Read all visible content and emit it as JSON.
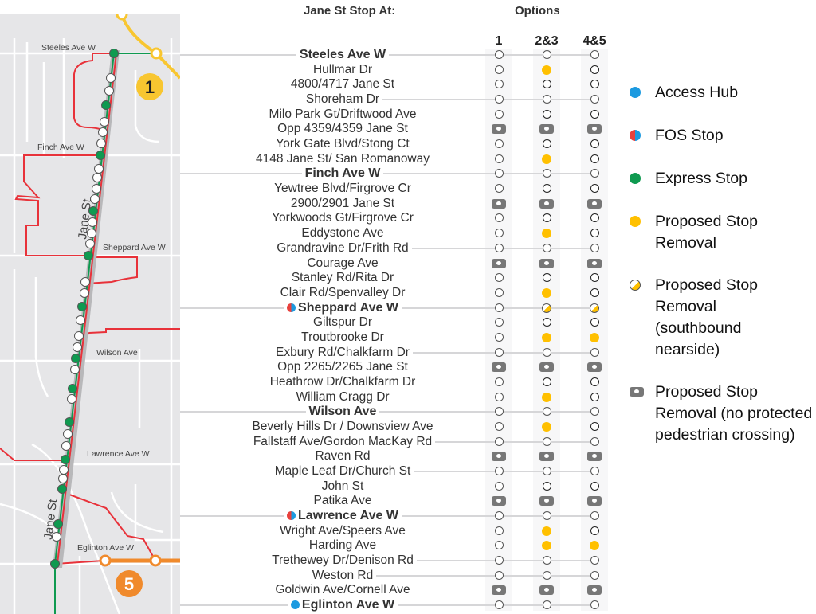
{
  "header": {
    "stop_col_title": "Jane St Stop At:",
    "options_title": "Options",
    "option_columns": [
      "1",
      "2&3",
      "4&5"
    ]
  },
  "map": {
    "street_labels": [
      "Steeles Ave W",
      "Finch Ave W",
      "Sheppard Ave W",
      "Wilson Ave",
      "Lawrence Ave W",
      "Eglinton Ave W",
      "Jane St",
      "Jane St"
    ],
    "line_badges": [
      {
        "label": "1",
        "color": "#f8c630"
      },
      {
        "label": "5",
        "color": "#f08a2c"
      }
    ],
    "colors": {
      "route_red": "#e8323a",
      "express_green": "#0f9a50",
      "line1_yellow": "#f8c630",
      "line5_orange": "#f08a2c",
      "land": "#e6e6e8",
      "roads": "#ffffff"
    }
  },
  "marker_types": {
    "open": "regular stop (retained)",
    "rem": "Proposed Stop Removal",
    "sb": "Proposed Stop Removal (southbound nearside)",
    "nopx": "Proposed Stop Removal (no protected pedestrian crossing)"
  },
  "stops": [
    {
      "name": "Steeles Ave W",
      "major": true,
      "badge": "",
      "options": [
        "open",
        "open",
        "open"
      ]
    },
    {
      "name": "Hullmar Dr",
      "major": false,
      "badge": "",
      "options": [
        "open",
        "rem",
        "open"
      ]
    },
    {
      "name": "4800/4717 Jane St",
      "major": false,
      "badge": "",
      "options": [
        "open",
        "open",
        "open"
      ]
    },
    {
      "name": "Shoreham Dr",
      "major": false,
      "badge": "",
      "connector": true,
      "options": [
        "open",
        "open",
        "open"
      ]
    },
    {
      "name": "Milo Park Gt/Driftwood Ave",
      "major": false,
      "badge": "",
      "options": [
        "open",
        "open",
        "open"
      ]
    },
    {
      "name": "Opp 4359/4359 Jane St",
      "major": false,
      "badge": "",
      "options": [
        "nopx",
        "nopx",
        "nopx"
      ]
    },
    {
      "name": "York Gate Blvd/Stong Ct",
      "major": false,
      "badge": "",
      "options": [
        "open",
        "open",
        "open"
      ]
    },
    {
      "name": "4148 Jane St/  San Romanoway",
      "major": false,
      "badge": "",
      "options": [
        "open",
        "rem",
        "open"
      ]
    },
    {
      "name": "Finch Ave W",
      "major": true,
      "badge": "",
      "options": [
        "open",
        "open",
        "open"
      ]
    },
    {
      "name": "Yewtree Blvd/Firgrove Cr",
      "major": false,
      "badge": "",
      "options": [
        "open",
        "open",
        "open"
      ]
    },
    {
      "name": "2900/2901 Jane St",
      "major": false,
      "badge": "",
      "options": [
        "nopx",
        "nopx",
        "nopx"
      ]
    },
    {
      "name": "Yorkwoods Gt/Firgrove Cr",
      "major": false,
      "badge": "",
      "options": [
        "open",
        "open",
        "open"
      ]
    },
    {
      "name": "Eddystone Ave",
      "major": false,
      "badge": "",
      "options": [
        "open",
        "rem",
        "open"
      ]
    },
    {
      "name": "Grandravine Dr/Frith Rd",
      "major": false,
      "badge": "",
      "connector": true,
      "options": [
        "open",
        "open",
        "open"
      ]
    },
    {
      "name": "Courage Ave",
      "major": false,
      "badge": "",
      "options": [
        "nopx",
        "nopx",
        "nopx"
      ]
    },
    {
      "name": "Stanley Rd/Rita Dr",
      "major": false,
      "badge": "",
      "options": [
        "open",
        "open",
        "open"
      ]
    },
    {
      "name": "Clair Rd/Spenvalley Dr",
      "major": false,
      "badge": "",
      "options": [
        "open",
        "rem",
        "open"
      ]
    },
    {
      "name": "Sheppard Ave W",
      "major": true,
      "badge": "fos",
      "options": [
        "open",
        "sb",
        "sb"
      ]
    },
    {
      "name": "Giltspur Dr",
      "major": false,
      "badge": "",
      "options": [
        "open",
        "open",
        "open"
      ]
    },
    {
      "name": "Troutbrooke Dr",
      "major": false,
      "badge": "",
      "options": [
        "open",
        "rem",
        "rem"
      ]
    },
    {
      "name": "Exbury Rd/Chalkfarm Dr",
      "major": false,
      "badge": "",
      "connector": true,
      "options": [
        "open",
        "open",
        "open"
      ]
    },
    {
      "name": "Opp 2265/2265 Jane St",
      "major": false,
      "badge": "",
      "options": [
        "nopx",
        "nopx",
        "nopx"
      ]
    },
    {
      "name": "Heathrow Dr/Chalkfarm Dr",
      "major": false,
      "badge": "",
      "options": [
        "open",
        "open",
        "open"
      ]
    },
    {
      "name": "William Cragg Dr",
      "major": false,
      "badge": "",
      "options": [
        "open",
        "rem",
        "open"
      ]
    },
    {
      "name": "Wilson Ave",
      "major": true,
      "badge": "",
      "options": [
        "open",
        "open",
        "open"
      ]
    },
    {
      "name": "Beverly Hills Dr / Downsview Ave",
      "major": false,
      "badge": "",
      "options": [
        "open",
        "rem",
        "open"
      ]
    },
    {
      "name": "Fallstaff Ave/Gordon MacKay Rd",
      "major": false,
      "badge": "",
      "connector": true,
      "options": [
        "open",
        "open",
        "open"
      ]
    },
    {
      "name": "Raven Rd",
      "major": false,
      "badge": "",
      "options": [
        "nopx",
        "nopx",
        "nopx"
      ]
    },
    {
      "name": "Maple Leaf Dr/Church St",
      "major": false,
      "badge": "",
      "connector": true,
      "options": [
        "open",
        "open",
        "open"
      ]
    },
    {
      "name": "John St",
      "major": false,
      "badge": "",
      "options": [
        "open",
        "open",
        "open"
      ]
    },
    {
      "name": "Patika Ave",
      "major": false,
      "badge": "",
      "options": [
        "nopx",
        "nopx",
        "nopx"
      ]
    },
    {
      "name": "Lawrence Ave W",
      "major": true,
      "badge": "fos",
      "options": [
        "open",
        "open",
        "open"
      ]
    },
    {
      "name": "Wright Ave/Speers Ave",
      "major": false,
      "badge": "",
      "options": [
        "open",
        "rem",
        "open"
      ]
    },
    {
      "name": "Harding Ave",
      "major": false,
      "badge": "",
      "options": [
        "open",
        "rem",
        "rem"
      ]
    },
    {
      "name": "Trethewey Dr/Denison Rd",
      "major": false,
      "badge": "",
      "connector": true,
      "options": [
        "open",
        "open",
        "open"
      ]
    },
    {
      "name": "Weston Rd",
      "major": false,
      "badge": "",
      "connector": true,
      "options": [
        "open",
        "open",
        "open"
      ]
    },
    {
      "name": "Goldwin Ave/Cornell Ave",
      "major": false,
      "badge": "",
      "options": [
        "nopx",
        "nopx",
        "nopx"
      ]
    },
    {
      "name": "Eglinton Ave W",
      "major": true,
      "badge": "hub",
      "options": [
        "open",
        "open",
        "open"
      ]
    }
  ],
  "legend": [
    {
      "symbol": "hub",
      "label": "Access Hub",
      "color": "#1c9ae0"
    },
    {
      "symbol": "fos",
      "label": "FOS Stop"
    },
    {
      "symbol": "express",
      "label": "Express Stop",
      "color": "#0f9a50"
    },
    {
      "symbol": "rem",
      "label": "Proposed Stop Removal",
      "color": "#ffc000"
    },
    {
      "symbol": "sb",
      "label": "Proposed Stop Removal (southbound nearside)"
    },
    {
      "symbol": "nopx",
      "label": "Proposed Stop Removal (no protected pedestrian crossing)"
    }
  ]
}
